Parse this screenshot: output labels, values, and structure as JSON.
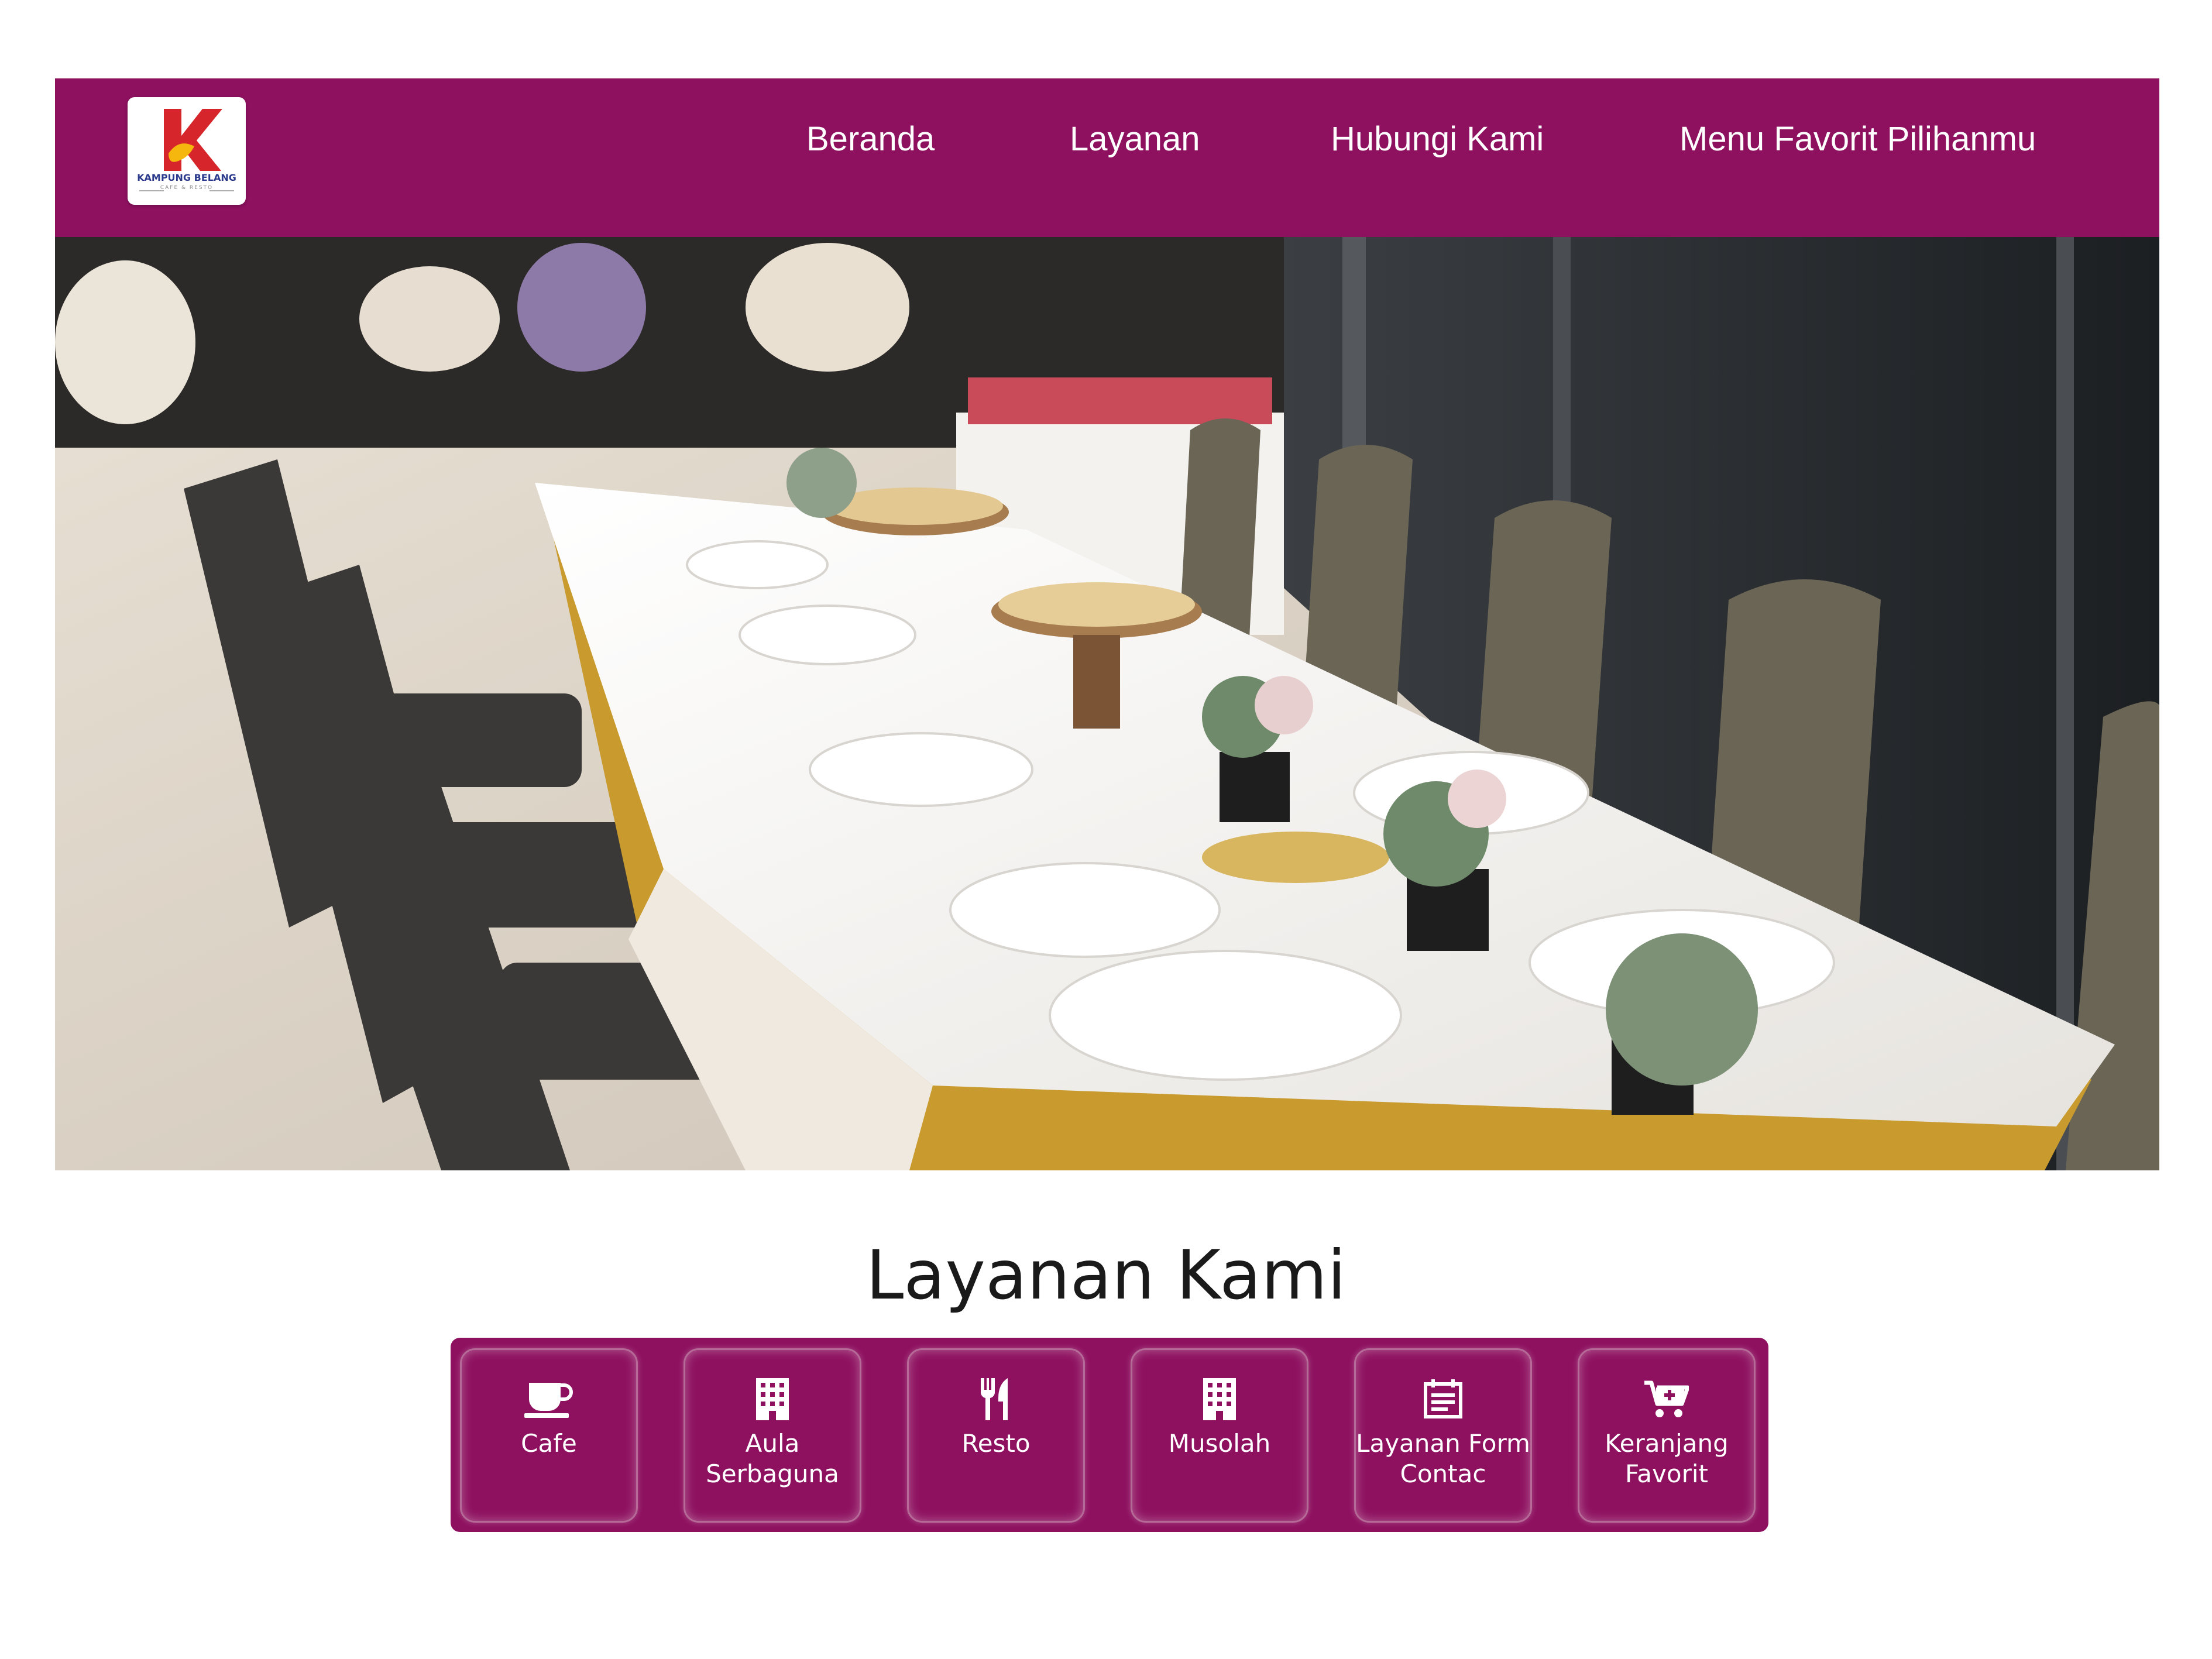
{
  "brand": {
    "logo_letter": "K",
    "logo_name": "KAMPUNG BELANG",
    "logo_tagline": "CAFE & RESTO"
  },
  "nav": {
    "items": [
      {
        "label": "Beranda"
      },
      {
        "label": "Layanan"
      },
      {
        "label": "Hubungi Kami"
      },
      {
        "label": "Menu Favorit Pilihanmu"
      }
    ]
  },
  "services": {
    "title": "Layanan Kami",
    "items": [
      {
        "label": "Cafe",
        "icon": "coffee-cup-icon"
      },
      {
        "label": "Aula Serbaguna",
        "icon": "building-icon"
      },
      {
        "label": "Resto",
        "icon": "utensils-icon"
      },
      {
        "label": "Musolah",
        "icon": "building-icon"
      },
      {
        "label": "Layanan Form Contac",
        "icon": "form-icon"
      },
      {
        "label": "Keranjang Favorit",
        "icon": "cart-plus-icon"
      }
    ]
  },
  "colors": {
    "brand": "#8e1160",
    "text_on_brand": "#ffffff"
  }
}
